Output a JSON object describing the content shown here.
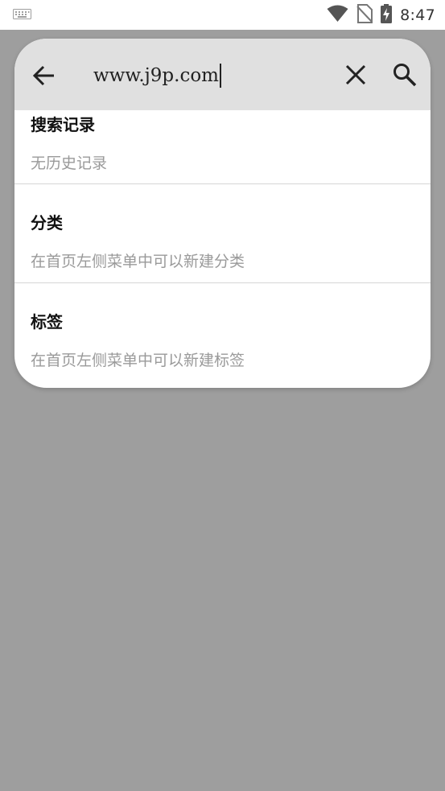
{
  "status_bar": {
    "time": "8:47",
    "icons": [
      "keyboard-icon",
      "wifi-icon",
      "no-sim-icon",
      "battery-charging-icon"
    ]
  },
  "search": {
    "query": "www.j9p.com",
    "back_icon": "arrow-left-icon",
    "clear_icon": "close-icon",
    "search_icon": "search-icon"
  },
  "sections": {
    "history": {
      "title": "搜索记录",
      "hint": "无历史记录"
    },
    "category": {
      "title": "分类",
      "hint": "在首页左侧菜单中可以新建分类"
    },
    "tags": {
      "title": "标签",
      "hint": "在首页左侧菜单中可以新建标签"
    }
  },
  "colors": {
    "scrim": "#9e9e9e",
    "search_bar_bg": "#e0e0e0",
    "hint_text": "#9a9a9a",
    "divider": "#d6d6d6"
  }
}
